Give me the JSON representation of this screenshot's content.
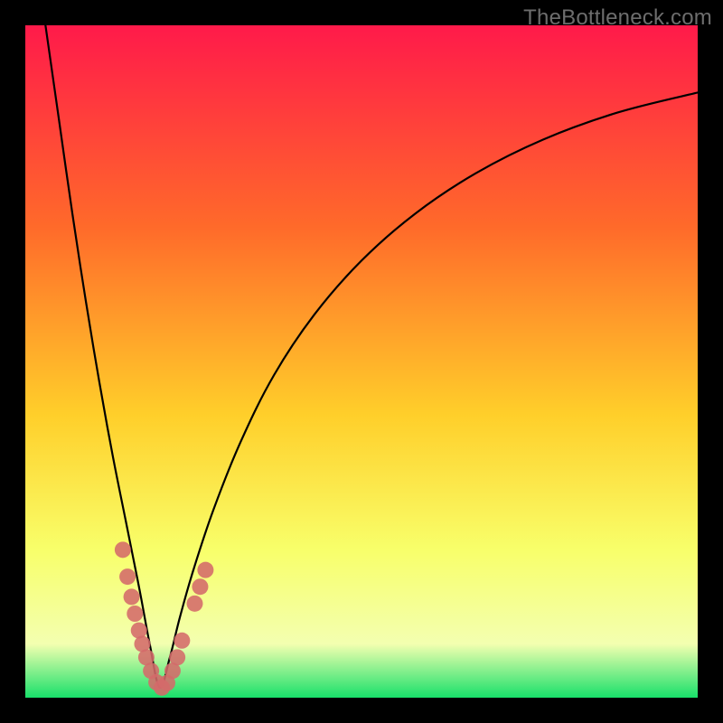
{
  "watermark": "TheBottleneck.com",
  "colors": {
    "frame": "#000000",
    "gradient_top": "#ff1a4a",
    "gradient_upper_mid": "#ff6a2a",
    "gradient_mid": "#ffcf2a",
    "gradient_lower_mid": "#f8ff6a",
    "gradient_pale": "#f3ffb0",
    "gradient_bottom": "#18e06a",
    "curve": "#000000",
    "markers": "#d46a6a"
  },
  "chart_data": {
    "type": "line",
    "title": "",
    "xlabel": "",
    "ylabel": "",
    "xlim": [
      0,
      100
    ],
    "ylim": [
      0,
      100
    ],
    "note": "No numeric axis ticks are shown; values are normalized 0-100. The curve is a V-shaped bottleneck profile with its minimum near x≈20, y≈0. Salmon circular markers cluster on both branches near the trough in the y≈2–20 band.",
    "series": [
      {
        "name": "bottleneck-curve",
        "x": [
          3,
          5,
          7,
          9,
          11,
          13,
          15,
          17,
          18.5,
          20,
          21.5,
          23,
          25,
          28,
          32,
          37,
          43,
          50,
          58,
          67,
          77,
          88,
          100
        ],
        "y": [
          100,
          86,
          72,
          59,
          47,
          36,
          26,
          16,
          8,
          1.5,
          6,
          12,
          19,
          28,
          38,
          48,
          57,
          65,
          72,
          78,
          83,
          87,
          90
        ]
      }
    ],
    "markers": [
      {
        "x": 14.5,
        "y": 22
      },
      {
        "x": 15.2,
        "y": 18
      },
      {
        "x": 15.8,
        "y": 15
      },
      {
        "x": 16.3,
        "y": 12.5
      },
      {
        "x": 16.9,
        "y": 10
      },
      {
        "x": 17.4,
        "y": 8
      },
      {
        "x": 18.0,
        "y": 6
      },
      {
        "x": 18.7,
        "y": 4
      },
      {
        "x": 19.5,
        "y": 2.3
      },
      {
        "x": 20.3,
        "y": 1.5
      },
      {
        "x": 21.1,
        "y": 2.2
      },
      {
        "x": 21.9,
        "y": 4
      },
      {
        "x": 22.6,
        "y": 6
      },
      {
        "x": 23.3,
        "y": 8.5
      },
      {
        "x": 25.2,
        "y": 14
      },
      {
        "x": 26.0,
        "y": 16.5
      },
      {
        "x": 26.8,
        "y": 19
      }
    ]
  }
}
